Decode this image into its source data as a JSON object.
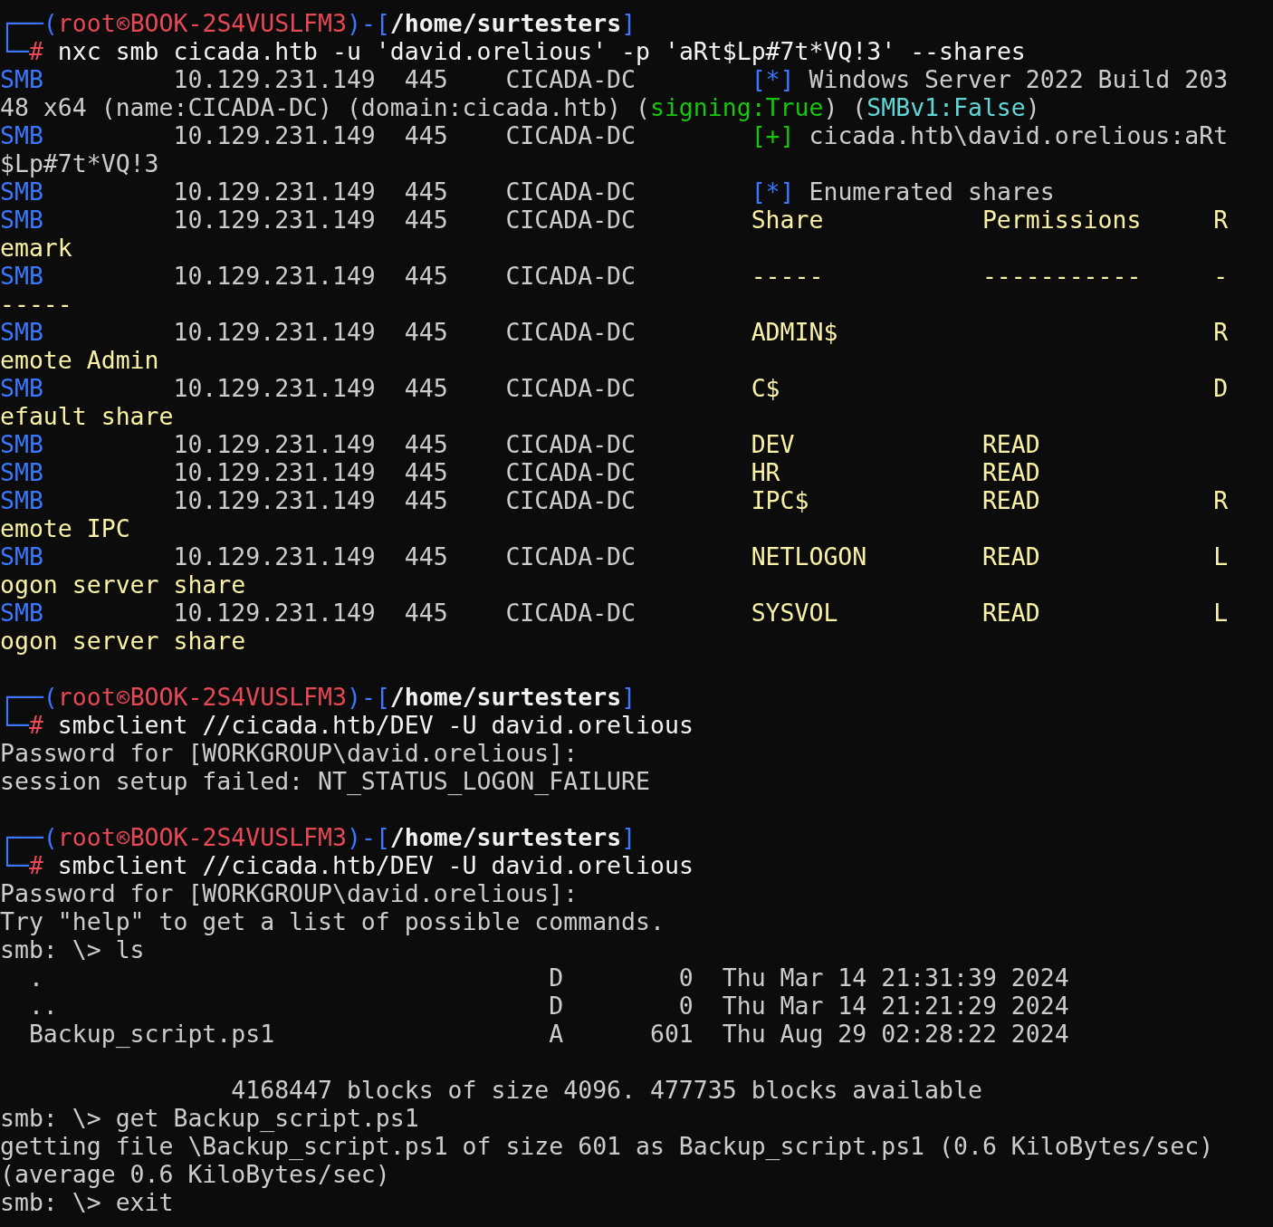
{
  "terminal": {
    "lines": [
      {
        "kind": "text",
        "segments": [
          {
            "kind": "frame",
            "text": "┌──("
          },
          {
            "kind": "user",
            "text": "root"
          },
          {
            "kind": "symbol"
          },
          {
            "kind": "host",
            "text": "BOOK-2S4VUSLFM3"
          },
          {
            "kind": "frame",
            "text": ")-["
          },
          {
            "kind": "path",
            "text": "/home/surtesters"
          },
          {
            "kind": "frame",
            "text": "]"
          }
        ]
      },
      {
        "kind": "text",
        "segments": [
          {
            "kind": "frame",
            "text": "└─"
          },
          {
            "kind": "hash",
            "text": "#"
          },
          {
            "kind": "command",
            "text": " nxc smb cicada.htb -u 'david.orelious' -p 'aRt$Lp#7t*VQ!3' --shares"
          }
        ]
      },
      {
        "kind": "text",
        "segments": [
          {
            "kind": "protocol",
            "text": "SMB"
          },
          {
            "kind": "text",
            "text": "         10.129.231.149  445    CICADA-DC        "
          },
          {
            "kind": "info",
            "text": "[*]"
          },
          {
            "kind": "text",
            "text": " Windows Server 2022 Build 203"
          }
        ]
      },
      {
        "kind": "text",
        "segments": [
          {
            "kind": "text",
            "text": "48 x64 (name:CICADA-DC) (domain:cicada.htb) ("
          },
          {
            "kind": "signing",
            "text": "signing:True"
          },
          {
            "kind": "text",
            "text": ") ("
          },
          {
            "kind": "smbv1",
            "text": "SMBv1:False"
          },
          {
            "kind": "text",
            "text": ")"
          }
        ]
      },
      {
        "kind": "text",
        "segments": [
          {
            "kind": "protocol",
            "text": "SMB"
          },
          {
            "kind": "text",
            "text": "         10.129.231.149  445    CICADA-DC        "
          },
          {
            "kind": "ok",
            "text": "[+]"
          },
          {
            "kind": "text",
            "text": " cicada.htb\\david.orelious:aRt"
          }
        ]
      },
      {
        "kind": "text",
        "segments": [
          {
            "kind": "text",
            "text": "$Lp#7t*VQ!3"
          }
        ]
      },
      {
        "kind": "text",
        "segments": [
          {
            "kind": "protocol",
            "text": "SMB"
          },
          {
            "kind": "text",
            "text": "         10.129.231.149  445    CICADA-DC        "
          },
          {
            "kind": "info",
            "text": "[*]"
          },
          {
            "kind": "text",
            "text": " Enumerated shares"
          }
        ]
      },
      {
        "kind": "text",
        "segments": [
          {
            "kind": "protocol",
            "text": "SMB"
          },
          {
            "kind": "text",
            "text": "         10.129.231.149  445    CICADA-DC        "
          },
          {
            "kind": "share",
            "text": "Share           Permissions     R"
          }
        ]
      },
      {
        "kind": "text",
        "segments": [
          {
            "kind": "share",
            "text": "emark"
          }
        ]
      },
      {
        "kind": "text",
        "segments": [
          {
            "kind": "protocol",
            "text": "SMB"
          },
          {
            "kind": "text",
            "text": "         10.129.231.149  445    CICADA-DC        "
          },
          {
            "kind": "share",
            "text": "-----           -----------     -"
          }
        ]
      },
      {
        "kind": "text",
        "segments": [
          {
            "kind": "share",
            "text": "-----"
          }
        ]
      },
      {
        "kind": "text",
        "segments": [
          {
            "kind": "protocol",
            "text": "SMB"
          },
          {
            "kind": "text",
            "text": "         10.129.231.149  445    CICADA-DC        "
          },
          {
            "kind": "share",
            "text": "ADMIN$                          R"
          }
        ]
      },
      {
        "kind": "text",
        "segments": [
          {
            "kind": "share",
            "text": "emote Admin"
          }
        ]
      },
      {
        "kind": "text",
        "segments": [
          {
            "kind": "protocol",
            "text": "SMB"
          },
          {
            "kind": "text",
            "text": "         10.129.231.149  445    CICADA-DC        "
          },
          {
            "kind": "share",
            "text": "C$                              D"
          }
        ]
      },
      {
        "kind": "text",
        "segments": [
          {
            "kind": "share",
            "text": "efault share"
          }
        ]
      },
      {
        "kind": "text",
        "segments": [
          {
            "kind": "protocol",
            "text": "SMB"
          },
          {
            "kind": "text",
            "text": "         10.129.231.149  445    CICADA-DC        "
          },
          {
            "kind": "share",
            "text": "DEV             READ"
          }
        ]
      },
      {
        "kind": "text",
        "segments": [
          {
            "kind": "protocol",
            "text": "SMB"
          },
          {
            "kind": "text",
            "text": "         10.129.231.149  445    CICADA-DC        "
          },
          {
            "kind": "share",
            "text": "HR              READ"
          }
        ]
      },
      {
        "kind": "text",
        "segments": [
          {
            "kind": "protocol",
            "text": "SMB"
          },
          {
            "kind": "text",
            "text": "         10.129.231.149  445    CICADA-DC        "
          },
          {
            "kind": "share",
            "text": "IPC$            READ            R"
          }
        ]
      },
      {
        "kind": "text",
        "segments": [
          {
            "kind": "share",
            "text": "emote IPC"
          }
        ]
      },
      {
        "kind": "text",
        "segments": [
          {
            "kind": "protocol",
            "text": "SMB"
          },
          {
            "kind": "text",
            "text": "         10.129.231.149  445    CICADA-DC        "
          },
          {
            "kind": "share",
            "text": "NETLOGON        READ            L"
          }
        ]
      },
      {
        "kind": "text",
        "segments": [
          {
            "kind": "share",
            "text": "ogon server share"
          }
        ]
      },
      {
        "kind": "text",
        "segments": [
          {
            "kind": "protocol",
            "text": "SMB"
          },
          {
            "kind": "text",
            "text": "         10.129.231.149  445    CICADA-DC        "
          },
          {
            "kind": "share",
            "text": "SYSVOL          READ            L"
          }
        ]
      },
      {
        "kind": "text",
        "segments": [
          {
            "kind": "share",
            "text": "ogon server share"
          }
        ]
      },
      {
        "kind": "blank"
      },
      {
        "kind": "text",
        "segments": [
          {
            "kind": "frame",
            "text": "┌──("
          },
          {
            "kind": "user",
            "text": "root"
          },
          {
            "kind": "symbol"
          },
          {
            "kind": "host",
            "text": "BOOK-2S4VUSLFM3"
          },
          {
            "kind": "frame",
            "text": ")-["
          },
          {
            "kind": "path",
            "text": "/home/surtesters"
          },
          {
            "kind": "frame",
            "text": "]"
          }
        ]
      },
      {
        "kind": "text",
        "segments": [
          {
            "kind": "frame",
            "text": "└─"
          },
          {
            "kind": "hash",
            "text": "#"
          },
          {
            "kind": "command",
            "text": " smbclient //cicada.htb/DEV -U david.orelious"
          }
        ]
      },
      {
        "kind": "text",
        "segments": [
          {
            "kind": "text",
            "text": "Password for [WORKGROUP\\david.orelious]:"
          }
        ]
      },
      {
        "kind": "text",
        "segments": [
          {
            "kind": "text",
            "text": "session setup failed: NT_STATUS_LOGON_FAILURE"
          }
        ]
      },
      {
        "kind": "blank"
      },
      {
        "kind": "text",
        "segments": [
          {
            "kind": "frame",
            "text": "┌──("
          },
          {
            "kind": "user",
            "text": "root"
          },
          {
            "kind": "symbol"
          },
          {
            "kind": "host",
            "text": "BOOK-2S4VUSLFM3"
          },
          {
            "kind": "frame",
            "text": ")-["
          },
          {
            "kind": "path",
            "text": "/home/surtesters"
          },
          {
            "kind": "frame",
            "text": "]"
          }
        ]
      },
      {
        "kind": "text",
        "segments": [
          {
            "kind": "frame",
            "text": "└─"
          },
          {
            "kind": "hash",
            "text": "#"
          },
          {
            "kind": "command",
            "text": " smbclient //cicada.htb/DEV -U david.orelious"
          }
        ]
      },
      {
        "kind": "text",
        "segments": [
          {
            "kind": "text",
            "text": "Password for [WORKGROUP\\david.orelious]:"
          }
        ]
      },
      {
        "kind": "text",
        "segments": [
          {
            "kind": "text",
            "text": "Try \"help\" to get a list of possible commands."
          }
        ]
      },
      {
        "kind": "text",
        "segments": [
          {
            "kind": "text",
            "text": "smb: \\> ls"
          }
        ]
      },
      {
        "kind": "text",
        "segments": [
          {
            "kind": "text",
            "text": "  .                                   D        0  Thu Mar 14 21:31:39 2024"
          }
        ]
      },
      {
        "kind": "text",
        "segments": [
          {
            "kind": "text",
            "text": "  ..                                  D        0  Thu Mar 14 21:21:29 2024"
          }
        ]
      },
      {
        "kind": "text",
        "segments": [
          {
            "kind": "text",
            "text": "  Backup_script.ps1                   A      601  Thu Aug 29 02:28:22 2024"
          }
        ]
      },
      {
        "kind": "blank"
      },
      {
        "kind": "text",
        "segments": [
          {
            "kind": "text",
            "text": "                4168447 blocks of size 4096. 477735 blocks available"
          }
        ]
      },
      {
        "kind": "text",
        "segments": [
          {
            "kind": "text",
            "text": "smb: \\> get Backup_script.ps1"
          }
        ]
      },
      {
        "kind": "text",
        "segments": [
          {
            "kind": "text",
            "text": "getting file \\Backup_script.ps1 of size 601 as Backup_script.ps1 (0.6 KiloBytes/sec)"
          }
        ]
      },
      {
        "kind": "text",
        "segments": [
          {
            "kind": "text",
            "text": "(average 0.6 KiloBytes/sec)"
          }
        ]
      },
      {
        "kind": "text",
        "segments": [
          {
            "kind": "text",
            "text": "smb: \\> exit"
          }
        ]
      }
    ]
  }
}
